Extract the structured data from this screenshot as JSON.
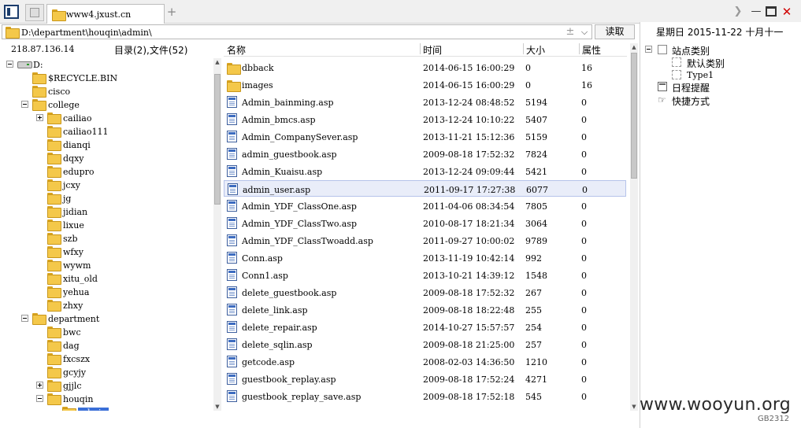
{
  "tabs": {
    "active_label": "www4.jxust.cn",
    "add_symbol": "+",
    "scroll_symbol": "❯"
  },
  "window": {
    "min_symbol": "—",
    "close_symbol": "✕"
  },
  "path": {
    "value": "D:\\department\\houqin\\admin\\",
    "plus_symbol": "±",
    "dropdown_symbol": "⌵",
    "read_label": "读取"
  },
  "left": {
    "ip": "218.87.136.14",
    "count": "目录(2),文件(52)"
  },
  "tree": [
    {
      "label": "D:",
      "icon": "drive",
      "toggle": "expanded",
      "level": 0
    },
    {
      "label": "$RECYCLE.BIN",
      "icon": "folder",
      "toggle": "",
      "level": 1
    },
    {
      "label": "cisco",
      "icon": "folder",
      "toggle": "",
      "level": 1
    },
    {
      "label": "college",
      "icon": "folder",
      "toggle": "expanded",
      "level": 1
    },
    {
      "label": "cailiao",
      "icon": "folder",
      "toggle": "collapsed",
      "level": 2
    },
    {
      "label": "cailiao111",
      "icon": "folder",
      "toggle": "",
      "level": 2
    },
    {
      "label": "dianqi",
      "icon": "folder",
      "toggle": "",
      "level": 2
    },
    {
      "label": "dqxy",
      "icon": "folder",
      "toggle": "",
      "level": 2
    },
    {
      "label": "edupro",
      "icon": "folder",
      "toggle": "",
      "level": 2
    },
    {
      "label": "jcxy",
      "icon": "folder",
      "toggle": "",
      "level": 2
    },
    {
      "label": "jg",
      "icon": "folder",
      "toggle": "",
      "level": 2
    },
    {
      "label": "jidian",
      "icon": "folder",
      "toggle": "",
      "level": 2
    },
    {
      "label": "lixue",
      "icon": "folder",
      "toggle": "",
      "level": 2
    },
    {
      "label": "szb",
      "icon": "folder",
      "toggle": "",
      "level": 2
    },
    {
      "label": "wfxy",
      "icon": "folder",
      "toggle": "",
      "level": 2
    },
    {
      "label": "wywm",
      "icon": "folder",
      "toggle": "",
      "level": 2
    },
    {
      "label": "xitu_old",
      "icon": "folder",
      "toggle": "",
      "level": 2
    },
    {
      "label": "yehua",
      "icon": "folder",
      "toggle": "",
      "level": 2
    },
    {
      "label": "zhxy",
      "icon": "folder",
      "toggle": "",
      "level": 2
    },
    {
      "label": "department",
      "icon": "folder",
      "toggle": "expanded",
      "level": 1
    },
    {
      "label": "bwc",
      "icon": "folder",
      "toggle": "",
      "level": 2
    },
    {
      "label": "dag",
      "icon": "folder",
      "toggle": "",
      "level": 2
    },
    {
      "label": "fxcszx",
      "icon": "folder",
      "toggle": "",
      "level": 2
    },
    {
      "label": "gcyjy",
      "icon": "folder",
      "toggle": "",
      "level": 2
    },
    {
      "label": "gjjlc",
      "icon": "folder",
      "toggle": "collapsed",
      "level": 2
    },
    {
      "label": "houqin",
      "icon": "folder",
      "toggle": "expanded",
      "level": 2
    },
    {
      "label": "admin",
      "icon": "folder",
      "toggle": "",
      "level": 3,
      "selected": true
    }
  ],
  "file_columns": {
    "name": "名称",
    "time": "时间",
    "size": "大小",
    "attr": "属性"
  },
  "files": [
    {
      "name": "dbback",
      "time": "2014-06-15 16:00:29",
      "size": "0",
      "attr": "16",
      "icon": "folder"
    },
    {
      "name": "images",
      "time": "2014-06-15 16:00:29",
      "size": "0",
      "attr": "16",
      "icon": "folder"
    },
    {
      "name": "Admin_bainming.asp",
      "time": "2013-12-24 08:48:52",
      "size": "5194",
      "attr": "0",
      "icon": "file"
    },
    {
      "name": "Admin_bmcs.asp",
      "time": "2013-12-24 10:10:22",
      "size": "5407",
      "attr": "0",
      "icon": "file"
    },
    {
      "name": "Admin_CompanySever.asp",
      "time": "2013-11-21 15:12:36",
      "size": "5159",
      "attr": "0",
      "icon": "file"
    },
    {
      "name": "admin_guestbook.asp",
      "time": "2009-08-18 17:52:32",
      "size": "7824",
      "attr": "0",
      "icon": "file"
    },
    {
      "name": "Admin_Kuaisu.asp",
      "time": "2013-12-24 09:09:44",
      "size": "5421",
      "attr": "0",
      "icon": "file"
    },
    {
      "name": "admin_user.asp",
      "time": "2011-09-17 17:27:38",
      "size": "6077",
      "attr": "0",
      "icon": "file",
      "selected": true
    },
    {
      "name": "Admin_YDF_ClassOne.asp",
      "time": "2011-04-06 08:34:54",
      "size": "7805",
      "attr": "0",
      "icon": "file"
    },
    {
      "name": "Admin_YDF_ClassTwo.asp",
      "time": "2010-08-17 18:21:34",
      "size": "3064",
      "attr": "0",
      "icon": "file"
    },
    {
      "name": "Admin_YDF_ClassTwoadd.asp",
      "time": "2011-09-27 10:00:02",
      "size": "9789",
      "attr": "0",
      "icon": "file"
    },
    {
      "name": "Conn.asp",
      "time": "2013-11-19 10:42:14",
      "size": "992",
      "attr": "0",
      "icon": "file"
    },
    {
      "name": "Conn1.asp",
      "time": "2013-10-21 14:39:12",
      "size": "1548",
      "attr": "0",
      "icon": "file"
    },
    {
      "name": "delete_guestbook.asp",
      "time": "2009-08-18 17:52:32",
      "size": "267",
      "attr": "0",
      "icon": "file"
    },
    {
      "name": "delete_link.asp",
      "time": "2009-08-18 18:22:48",
      "size": "255",
      "attr": "0",
      "icon": "file"
    },
    {
      "name": "delete_repair.asp",
      "time": "2014-10-27 15:57:57",
      "size": "254",
      "attr": "0",
      "icon": "file"
    },
    {
      "name": "delete_sqlin.asp",
      "time": "2009-08-18 21:25:00",
      "size": "257",
      "attr": "0",
      "icon": "file"
    },
    {
      "name": "getcode.asp",
      "time": "2008-02-03 14:36:50",
      "size": "1210",
      "attr": "0",
      "icon": "file"
    },
    {
      "name": "guestbook_replay.asp",
      "time": "2009-08-18 17:52:24",
      "size": "4271",
      "attr": "0",
      "icon": "file"
    },
    {
      "name": "guestbook_replay_save.asp",
      "time": "2009-08-18 17:52:18",
      "size": "545",
      "attr": "0",
      "icon": "file"
    }
  ],
  "right_panel": {
    "date": "星期日 2015-11-22 十月十一",
    "site_category": "站点类别",
    "default_category": "默认类别",
    "type1": "Type1",
    "schedule": "日程提醒",
    "shortcut": "快捷方式"
  },
  "watermark": {
    "text": "www.wooyun.org",
    "code": "GB2312"
  },
  "colors": {
    "selection": "#3a6fd8",
    "folder": "#f4c84a",
    "close": "#d00000"
  }
}
